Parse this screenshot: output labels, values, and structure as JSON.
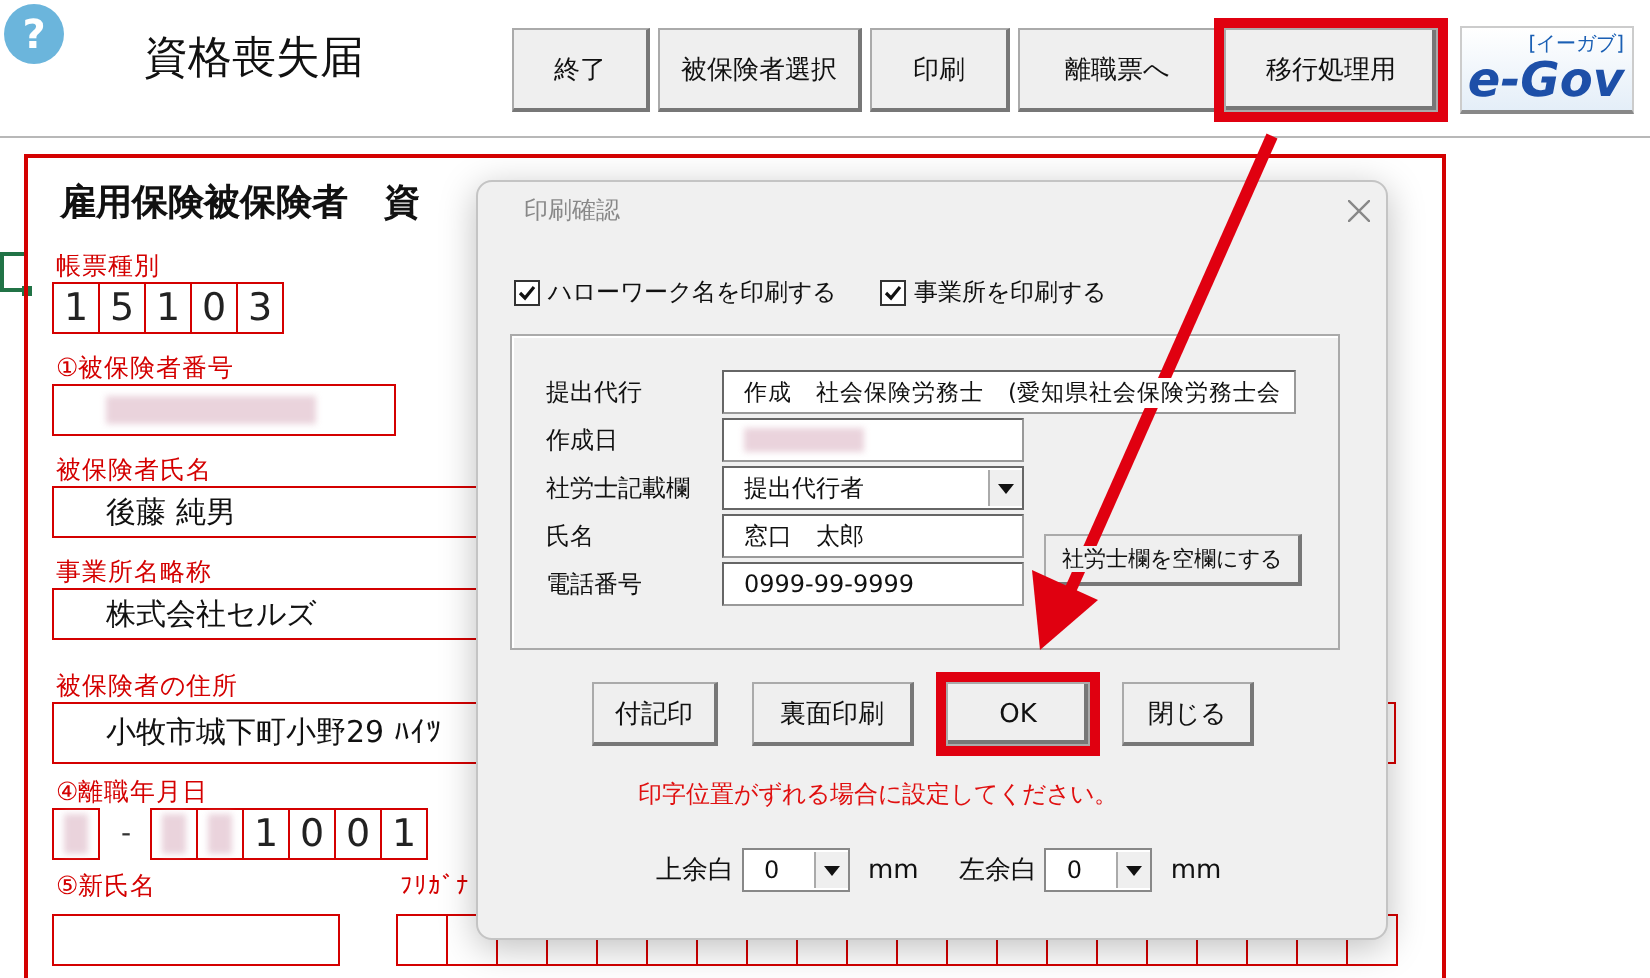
{
  "header": {
    "help": "?",
    "title": "資格喪失届",
    "buttons": [
      {
        "label": "終了",
        "highlighted": false
      },
      {
        "label": "被保険者選択",
        "highlighted": false
      },
      {
        "label": "印刷",
        "highlighted": false
      },
      {
        "label": "離職票へ",
        "highlighted": false
      },
      {
        "label": "移行処理用",
        "highlighted": true
      }
    ],
    "logo": {
      "text": "e-Gov",
      "ruby": "[イーガブ]"
    }
  },
  "form": {
    "title": "雇用保険被保険者　資",
    "sheet_type": {
      "label": "帳票種別",
      "digits": [
        "1",
        "5",
        "1",
        "0",
        "3"
      ]
    },
    "insured_number": {
      "label": "①被保険者番号",
      "redacted": true
    },
    "name": {
      "label": "被保険者氏名",
      "value": "後藤 純男"
    },
    "office": {
      "label": "事業所名略称",
      "value": "株式会社セルズ"
    },
    "address": {
      "label": "被保険者の住所",
      "value": "小牧市城下町小野29 ﾊｲﾂ"
    },
    "leave_date": {
      "label": "④離職年月日",
      "cells": [
        {
          "kind": "redacted"
        },
        {
          "kind": "separator",
          "text": "-"
        },
        {
          "kind": "redacted"
        },
        {
          "kind": "redacted"
        },
        {
          "kind": "digit",
          "text": "1"
        },
        {
          "kind": "digit",
          "text": "0"
        },
        {
          "kind": "digit",
          "text": "0"
        },
        {
          "kind": "digit",
          "text": "1"
        }
      ]
    },
    "new_name": {
      "label": "⑤新氏名"
    },
    "furigana": {
      "label": "ﾌﾘｶﾞﾅ"
    }
  },
  "dialog": {
    "title": "印刷確認",
    "checkboxes": [
      {
        "label": "ハローワーク名を印刷する",
        "checked": true
      },
      {
        "label": "事業所を印刷する",
        "checked": true
      }
    ],
    "rows": [
      {
        "kind": "text",
        "label": "提出代行",
        "value": "作成　社会保険労務士　(愛知県社会保険労務士会"
      },
      {
        "kind": "redacted",
        "label": "作成日"
      },
      {
        "kind": "select",
        "label": "社労士記載欄",
        "value": "提出代行者"
      },
      {
        "kind": "text",
        "label": "氏名",
        "value": "窓口　太郎"
      },
      {
        "kind": "text",
        "label": "電話番号",
        "value": "0999-99-9999"
      }
    ],
    "clear_button": "社労士欄を空欄にする",
    "buttons": [
      {
        "label": "付記印",
        "highlighted": false
      },
      {
        "label": "裏面印刷",
        "highlighted": false
      },
      {
        "label": "OK",
        "highlighted": true
      },
      {
        "label": "閉じる",
        "highlighted": false
      }
    ],
    "note": "印字位置がずれる場合に設定してください。",
    "margins": [
      {
        "label": "上余白",
        "value": "0",
        "unit": "mm"
      },
      {
        "label": "左余白",
        "value": "0",
        "unit": "mm"
      }
    ]
  }
}
